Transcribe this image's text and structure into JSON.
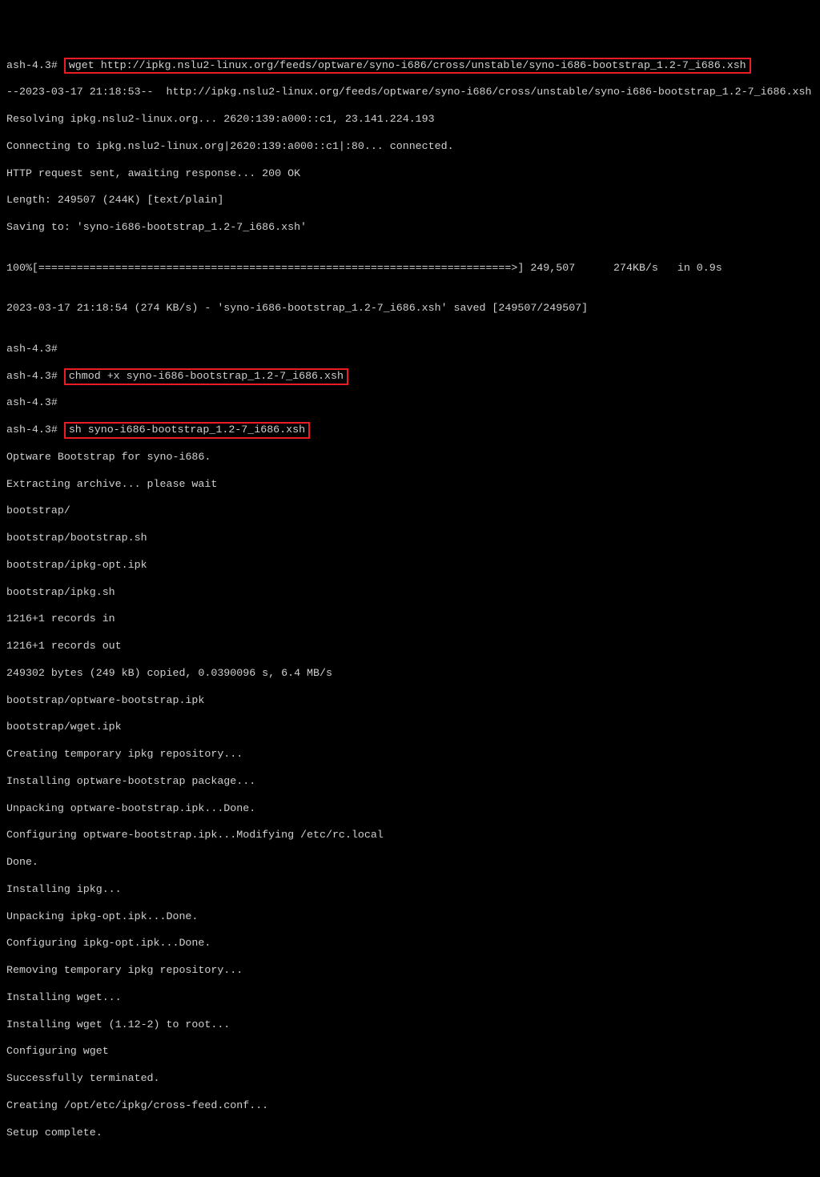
{
  "prompt": "ash-4.3#",
  "cmd1": "wget http://ipkg.nslu2-linux.org/feeds/optware/syno-i686/cross/unstable/syno-i686-bootstrap_1.2-7_i686.xsh",
  "out1_l1": "--2023-03-17 21:18:53--  http://ipkg.nslu2-linux.org/feeds/optware/syno-i686/cross/unstable/syno-i686-bootstrap_1.2-7_i686.xsh",
  "out1_l2": "Resolving ipkg.nslu2-linux.org... 2620:139:a000::c1, 23.141.224.193",
  "out1_l3": "Connecting to ipkg.nslu2-linux.org|2620:139:a000::c1|:80... connected.",
  "out1_l4": "HTTP request sent, awaiting response... 200 OK",
  "out1_l5": "Length: 249507 (244K) [text/plain]",
  "out1_l6": "Saving to: 'syno-i686-bootstrap_1.2-7_i686.xsh'",
  "out1_l7": "",
  "out1_l8": "100%[==========================================================================>] 249,507      274KB/s   in 0.9s",
  "out1_l9": "",
  "out1_l10": "2023-03-17 21:18:54 (274 KB/s) - 'syno-i686-bootstrap_1.2-7_i686.xsh' saved [249507/249507]",
  "out1_l11": "",
  "cmd2": "chmod +x syno-i686-bootstrap_1.2-7_i686.xsh",
  "cmd3": "sh syno-i686-bootstrap_1.2-7_i686.xsh",
  "out3_l1": "Optware Bootstrap for syno-i686.",
  "out3_l2": "Extracting archive... please wait",
  "out3_l3": "bootstrap/",
  "out3_l4": "bootstrap/bootstrap.sh",
  "out3_l5": "bootstrap/ipkg-opt.ipk",
  "out3_l6": "bootstrap/ipkg.sh",
  "out3_l7": "1216+1 records in",
  "out3_l8": "1216+1 records out",
  "out3_l9": "249302 bytes (249 kB) copied, 0.0390096 s, 6.4 MB/s",
  "out3_l10": "bootstrap/optware-bootstrap.ipk",
  "out3_l11": "bootstrap/wget.ipk",
  "out3_l12": "Creating temporary ipkg repository...",
  "out3_l13": "Installing optware-bootstrap package...",
  "out3_l14": "Unpacking optware-bootstrap.ipk...Done.",
  "out3_l15": "Configuring optware-bootstrap.ipk...Modifying /etc/rc.local",
  "out3_l16": "Done.",
  "out3_l17": "Installing ipkg...",
  "out3_l18": "Unpacking ipkg-opt.ipk...Done.",
  "out3_l19": "Configuring ipkg-opt.ipk...Done.",
  "out3_l20": "Removing temporary ipkg repository...",
  "out3_l21": "Installing wget...",
  "out3_l22": "Installing wget (1.12-2) to root...",
  "out3_l23": "Configuring wget",
  "out3_l24": "Successfully terminated.",
  "out3_l25": "Creating /opt/etc/ipkg/cross-feed.conf...",
  "out3_l26": "Setup complete."
}
